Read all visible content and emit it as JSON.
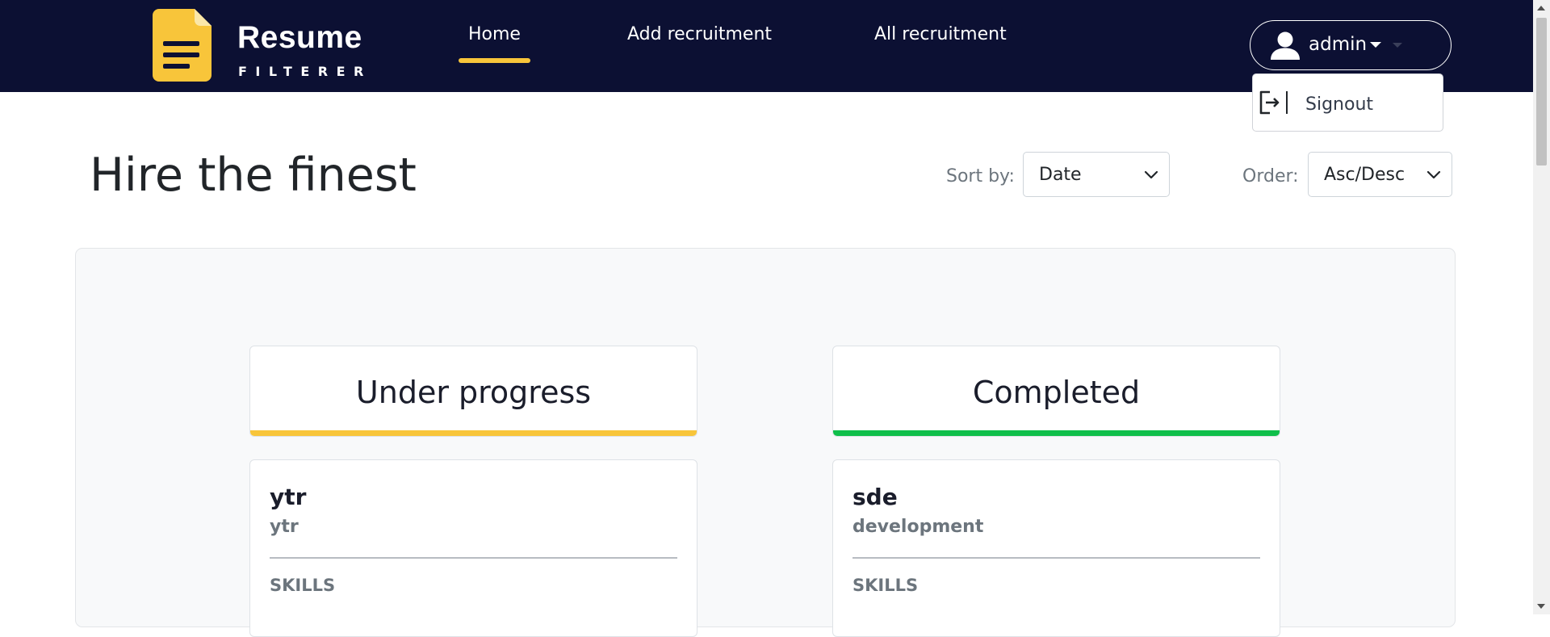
{
  "brand": {
    "name": "Resume",
    "tagline": "FILTERER",
    "accent": "#f8c53a",
    "navbar_bg": "#0c1033"
  },
  "nav": {
    "items": [
      {
        "label": "Home",
        "active": true
      },
      {
        "label": "Add recruitment",
        "active": false
      },
      {
        "label": "All recruitment",
        "active": false
      }
    ]
  },
  "user": {
    "name": "admin",
    "icon": "user-avatar-icon"
  },
  "user_menu": {
    "items": [
      {
        "label": "Signout",
        "icon": "sign-out-icon"
      }
    ]
  },
  "page": {
    "title": "Hire the finest"
  },
  "filters": {
    "sort_label": "Sort by:",
    "sort_value": "Date",
    "order_label": "Order:",
    "order_value": "Asc/Desc"
  },
  "columns": [
    {
      "title": "Under progress",
      "color": "#f8c53a",
      "cards": [
        {
          "title": "ytr",
          "subtitle": "ytr",
          "section": "SKILLS"
        }
      ]
    },
    {
      "title": "Completed",
      "color": "#0fbf4a",
      "cards": [
        {
          "title": "sde",
          "subtitle": "development",
          "section": "SKILLS"
        }
      ]
    }
  ]
}
